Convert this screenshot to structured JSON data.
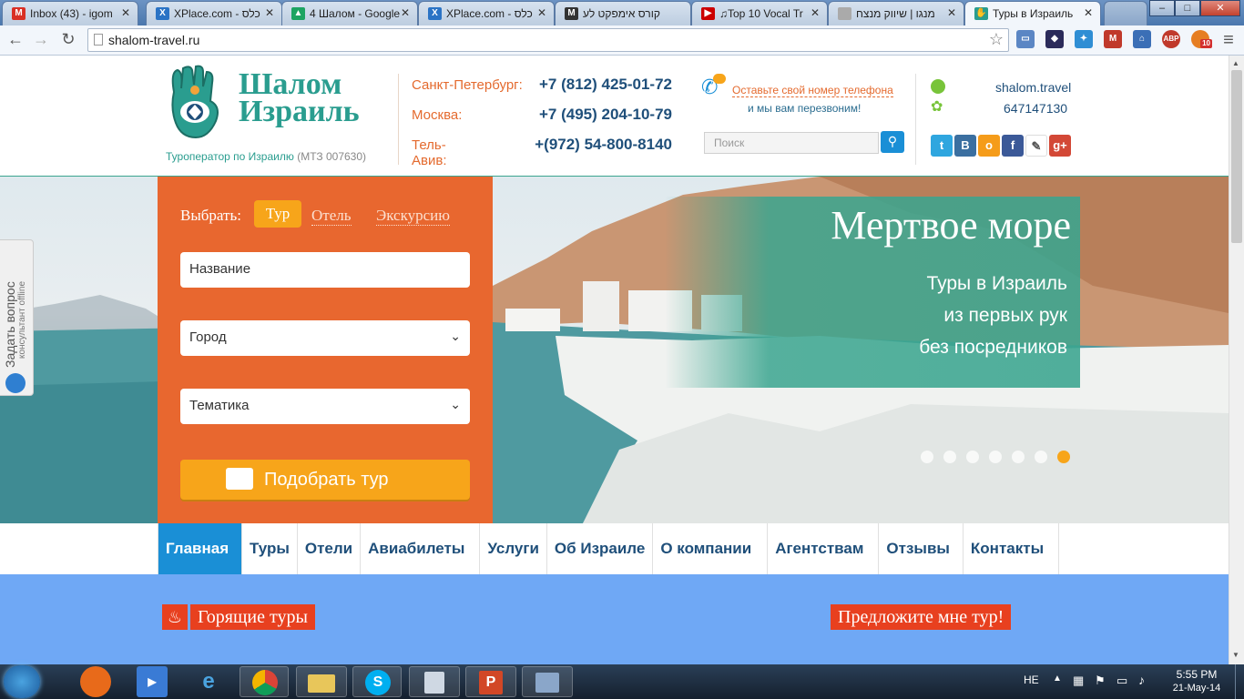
{
  "browser": {
    "tabs": [
      {
        "title": "Inbox (43) - igom",
        "favicon": "gmail-icon",
        "color": "#d93025"
      },
      {
        "title": "XPlace.com - כלס",
        "favicon": "xplace-icon",
        "color": "#2a73c5"
      },
      {
        "title": "4 Шалом - Google",
        "favicon": "google-drive-icon",
        "color": "#1da462"
      },
      {
        "title": "XPlace.com - כלס",
        "favicon": "xplace-icon",
        "color": "#2a73c5"
      },
      {
        "title": "קורס אימפקט לע",
        "favicon": "m-icon",
        "color": "#333333"
      },
      {
        "title": "♫Top 10 Vocal Tr",
        "favicon": "youtube-icon",
        "color": "#cc0000"
      },
      {
        "title": "מנגו | שיווק מנצח",
        "favicon": "page-icon",
        "color": "#888888"
      },
      {
        "title": "Туры в Израиль",
        "favicon": "hamsa-icon",
        "color": "#2a9d8f"
      }
    ],
    "window_controls": {
      "minimize": "–",
      "maximize": "□",
      "close": "✕"
    },
    "url": "shalom-travel.ru",
    "ext_badge": "10"
  },
  "header": {
    "logo_line1": "Шалом",
    "logo_line2": "Израиль",
    "tagline": "Туроператор по Израилю",
    "license": "(МТЗ 007630)",
    "phones": [
      {
        "city": "Санкт-Петербург:",
        "number": "+7 (812) 425-01-72"
      },
      {
        "city": "Москва:",
        "number": "+7 (495) 204-10-79"
      },
      {
        "city": "Тель-Авив:",
        "number": "+(972) 54-800-8140"
      }
    ],
    "callback_link": "Оставьте свой номер телефона",
    "callback_sub": "и мы вам перезвоним!",
    "search_placeholder": "Поиск",
    "skype": "shalom.travel",
    "icq": "647147130"
  },
  "search_box": {
    "choose_label": "Выбрать:",
    "options": [
      "Тур",
      "Отель",
      "Экскурсию"
    ],
    "name_placeholder": "Название",
    "city_select": "Город",
    "theme_select": "Тематика",
    "submit": "Подобрать тур"
  },
  "slider": {
    "title": "Мертвое море",
    "line1": "Туры в Израиль",
    "line2": "из первых рук",
    "line3": "без посредников",
    "dots_total": 7,
    "active_dot": 7
  },
  "side_widget": {
    "label": "Задать вопрос",
    "sub": "консультант offline"
  },
  "nav": [
    "Главная",
    "Туры",
    "Отели",
    "Авиабилеты",
    "Услуги",
    "Об Израиле",
    "О компании",
    "Агентствам",
    "Отзывы",
    "Контакты"
  ],
  "promo": {
    "hot": "Горящие туры",
    "offer": "Предложите мне тур!"
  },
  "taskbar": {
    "lang": "HE",
    "time": "5:55 PM",
    "date": "21-May-14"
  },
  "colors": {
    "orange": "#e8672f",
    "yellow_btn": "#f7a51a",
    "teal": "#3aa58f",
    "navy": "#1f4f7a",
    "nav_active": "#1a8fd6",
    "promo_bg": "#6fa8f5",
    "promo_red": "#e8401f"
  }
}
